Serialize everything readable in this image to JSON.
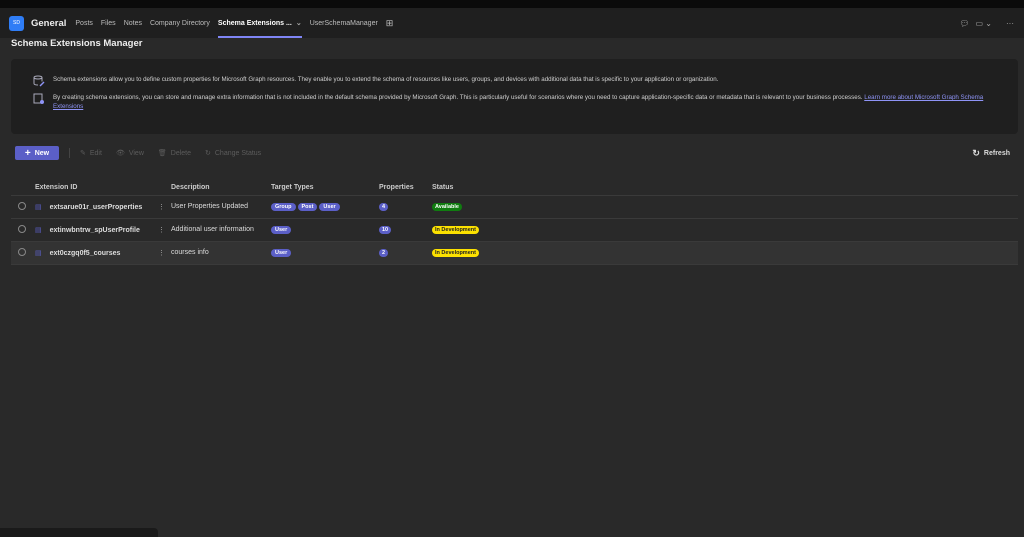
{
  "header": {
    "avatar": "SD",
    "channel": "General",
    "tabs": [
      "Posts",
      "Files",
      "Notes",
      "Company Directory",
      "Schema Extensions ...",
      "UserSchemaManager"
    ],
    "active_tab": 4
  },
  "page": {
    "title": "Schema Extensions Manager"
  },
  "info": {
    "line1": "Schema extensions allow you to define custom properties for Microsoft Graph resources. They enable you to extend the schema of resources like users, groups, and devices with additional data that is specific to your application or organization.",
    "line2": "By creating schema extensions, you can store and manage extra information that is not included in the default schema provided by Microsoft Graph. This is particularly useful for scenarios where you need to capture application-specific data or metadata that is relevant to your business processes.",
    "link": "Learn more about Microsoft Graph Schema Extensions"
  },
  "toolbar": {
    "new": "New",
    "edit": "Edit",
    "view": "View",
    "delete": "Delete",
    "change_status": "Change Status",
    "refresh": "Refresh"
  },
  "table": {
    "headers": [
      "Extension ID",
      "Description",
      "Target Types",
      "Properties",
      "Status"
    ],
    "rows": [
      {
        "id": "extsarue01r_userProperties",
        "desc": "User Properties Updated",
        "targets": [
          "Group",
          "Post",
          "User"
        ],
        "props": "4",
        "status": "Available"
      },
      {
        "id": "extinwbntrw_spUserProfile",
        "desc": "Additional user information",
        "targets": [
          "User"
        ],
        "props": "10",
        "status": "In Development"
      },
      {
        "id": "ext0czgq0f5_courses",
        "desc": "courses info",
        "targets": [
          "User"
        ],
        "props": "2",
        "status": "In Development"
      }
    ]
  },
  "colors": {
    "accent": "#5b5fc7",
    "available": "#107c10",
    "in_development": "#fce100"
  }
}
